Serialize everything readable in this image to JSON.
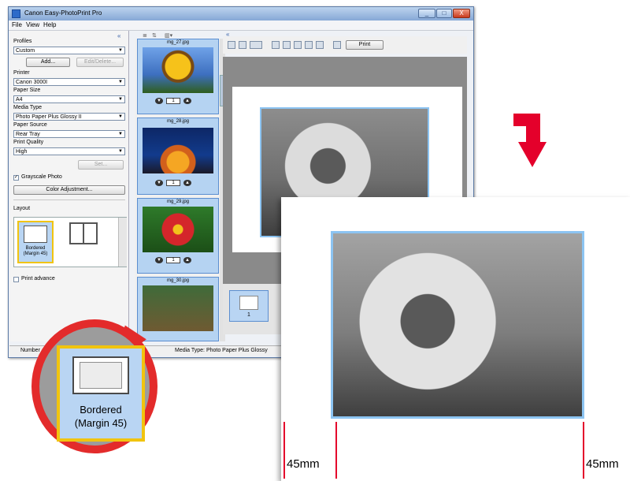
{
  "window": {
    "title": "Canon Easy-PhotoPrint Pro",
    "menu": [
      "File",
      "View",
      "Help"
    ],
    "controls": {
      "minimize": "_",
      "maximize": "□",
      "close": "X"
    }
  },
  "settings": {
    "profiles_label": "Profiles",
    "profiles_value": "Custom",
    "add_button": "Add...",
    "edit_delete_button": "Edit/Delete...",
    "printer_label": "Printer",
    "printer_value": "Canon 3000I",
    "paper_size_label": "Paper Size",
    "paper_size_value": "A4",
    "media_type_label": "Media Type",
    "media_type_value": "Photo Paper Plus Glossy II",
    "paper_source_label": "Paper Source",
    "paper_source_value": "Rear Tray",
    "print_quality_label": "Print Quality",
    "print_quality_value": "High",
    "set_button": "Set...",
    "grayscale_label": "Grayscale Photo",
    "grayscale_checked": true,
    "color_adjustment_button": "Color Adjustment...",
    "layout_label": "Layout",
    "layout_option_label": "Bordered (Margin 45)",
    "print_advanced_label": "Print advance"
  },
  "thumbnails": [
    {
      "name": "mg_27.jpg",
      "count": "1"
    },
    {
      "name": "mg_28.jpg",
      "count": "1"
    },
    {
      "name": "mg_29.jpg",
      "count": "1"
    },
    {
      "name": "mg_30.jpg",
      "count": ""
    }
  ],
  "toolbar": {
    "print_button": "Print"
  },
  "filmstrip": {
    "page_number": "1"
  },
  "status": {
    "left": "Number",
    "right": "Media Type: Photo Paper Plus Glossy"
  },
  "zoom": {
    "line1": "Bordered",
    "line2": "(Margin 45)"
  },
  "margins": {
    "left": "45mm",
    "right": "45mm"
  },
  "colors": {
    "accent": "#e4002b",
    "highlight": "#f1c40f",
    "selection": "#b9d5f3"
  }
}
